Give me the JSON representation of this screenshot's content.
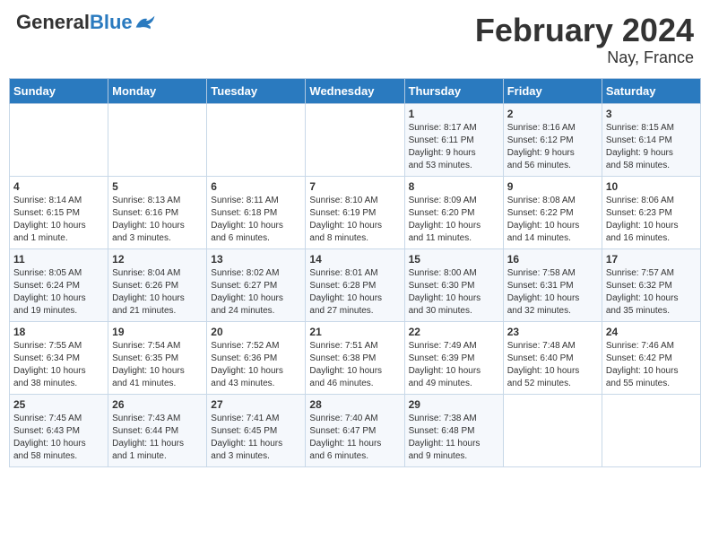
{
  "header": {
    "logo_general": "General",
    "logo_blue": "Blue",
    "month_year": "February 2024",
    "location": "Nay, France"
  },
  "days_of_week": [
    "Sunday",
    "Monday",
    "Tuesday",
    "Wednesday",
    "Thursday",
    "Friday",
    "Saturday"
  ],
  "weeks": [
    [
      {
        "day": "",
        "info": ""
      },
      {
        "day": "",
        "info": ""
      },
      {
        "day": "",
        "info": ""
      },
      {
        "day": "",
        "info": ""
      },
      {
        "day": "1",
        "info": "Sunrise: 8:17 AM\nSunset: 6:11 PM\nDaylight: 9 hours\nand 53 minutes."
      },
      {
        "day": "2",
        "info": "Sunrise: 8:16 AM\nSunset: 6:12 PM\nDaylight: 9 hours\nand 56 minutes."
      },
      {
        "day": "3",
        "info": "Sunrise: 8:15 AM\nSunset: 6:14 PM\nDaylight: 9 hours\nand 58 minutes."
      }
    ],
    [
      {
        "day": "4",
        "info": "Sunrise: 8:14 AM\nSunset: 6:15 PM\nDaylight: 10 hours\nand 1 minute."
      },
      {
        "day": "5",
        "info": "Sunrise: 8:13 AM\nSunset: 6:16 PM\nDaylight: 10 hours\nand 3 minutes."
      },
      {
        "day": "6",
        "info": "Sunrise: 8:11 AM\nSunset: 6:18 PM\nDaylight: 10 hours\nand 6 minutes."
      },
      {
        "day": "7",
        "info": "Sunrise: 8:10 AM\nSunset: 6:19 PM\nDaylight: 10 hours\nand 8 minutes."
      },
      {
        "day": "8",
        "info": "Sunrise: 8:09 AM\nSunset: 6:20 PM\nDaylight: 10 hours\nand 11 minutes."
      },
      {
        "day": "9",
        "info": "Sunrise: 8:08 AM\nSunset: 6:22 PM\nDaylight: 10 hours\nand 14 minutes."
      },
      {
        "day": "10",
        "info": "Sunrise: 8:06 AM\nSunset: 6:23 PM\nDaylight: 10 hours\nand 16 minutes."
      }
    ],
    [
      {
        "day": "11",
        "info": "Sunrise: 8:05 AM\nSunset: 6:24 PM\nDaylight: 10 hours\nand 19 minutes."
      },
      {
        "day": "12",
        "info": "Sunrise: 8:04 AM\nSunset: 6:26 PM\nDaylight: 10 hours\nand 21 minutes."
      },
      {
        "day": "13",
        "info": "Sunrise: 8:02 AM\nSunset: 6:27 PM\nDaylight: 10 hours\nand 24 minutes."
      },
      {
        "day": "14",
        "info": "Sunrise: 8:01 AM\nSunset: 6:28 PM\nDaylight: 10 hours\nand 27 minutes."
      },
      {
        "day": "15",
        "info": "Sunrise: 8:00 AM\nSunset: 6:30 PM\nDaylight: 10 hours\nand 30 minutes."
      },
      {
        "day": "16",
        "info": "Sunrise: 7:58 AM\nSunset: 6:31 PM\nDaylight: 10 hours\nand 32 minutes."
      },
      {
        "day": "17",
        "info": "Sunrise: 7:57 AM\nSunset: 6:32 PM\nDaylight: 10 hours\nand 35 minutes."
      }
    ],
    [
      {
        "day": "18",
        "info": "Sunrise: 7:55 AM\nSunset: 6:34 PM\nDaylight: 10 hours\nand 38 minutes."
      },
      {
        "day": "19",
        "info": "Sunrise: 7:54 AM\nSunset: 6:35 PM\nDaylight: 10 hours\nand 41 minutes."
      },
      {
        "day": "20",
        "info": "Sunrise: 7:52 AM\nSunset: 6:36 PM\nDaylight: 10 hours\nand 43 minutes."
      },
      {
        "day": "21",
        "info": "Sunrise: 7:51 AM\nSunset: 6:38 PM\nDaylight: 10 hours\nand 46 minutes."
      },
      {
        "day": "22",
        "info": "Sunrise: 7:49 AM\nSunset: 6:39 PM\nDaylight: 10 hours\nand 49 minutes."
      },
      {
        "day": "23",
        "info": "Sunrise: 7:48 AM\nSunset: 6:40 PM\nDaylight: 10 hours\nand 52 minutes."
      },
      {
        "day": "24",
        "info": "Sunrise: 7:46 AM\nSunset: 6:42 PM\nDaylight: 10 hours\nand 55 minutes."
      }
    ],
    [
      {
        "day": "25",
        "info": "Sunrise: 7:45 AM\nSunset: 6:43 PM\nDaylight: 10 hours\nand 58 minutes."
      },
      {
        "day": "26",
        "info": "Sunrise: 7:43 AM\nSunset: 6:44 PM\nDaylight: 11 hours\nand 1 minute."
      },
      {
        "day": "27",
        "info": "Sunrise: 7:41 AM\nSunset: 6:45 PM\nDaylight: 11 hours\nand 3 minutes."
      },
      {
        "day": "28",
        "info": "Sunrise: 7:40 AM\nSunset: 6:47 PM\nDaylight: 11 hours\nand 6 minutes."
      },
      {
        "day": "29",
        "info": "Sunrise: 7:38 AM\nSunset: 6:48 PM\nDaylight: 11 hours\nand 9 minutes."
      },
      {
        "day": "",
        "info": ""
      },
      {
        "day": "",
        "info": ""
      }
    ]
  ]
}
